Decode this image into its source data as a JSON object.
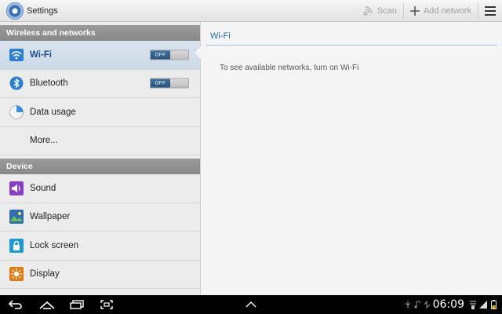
{
  "header": {
    "title": "Settings",
    "app_icon": "settings-gear-icon",
    "scan_label": "Scan",
    "add_network_label": "Add network"
  },
  "sidebar": {
    "sections": [
      {
        "header": "Wireless and networks",
        "items": [
          {
            "label": "Wi-Fi",
            "icon": "wifi-icon",
            "toggle": "OFF",
            "selected": true
          },
          {
            "label": "Bluetooth",
            "icon": "bluetooth-icon",
            "toggle": "OFF"
          },
          {
            "label": "Data usage",
            "icon": "data-usage-icon"
          },
          {
            "label": "More..."
          }
        ]
      },
      {
        "header": "Device",
        "items": [
          {
            "label": "Sound",
            "icon": "sound-icon"
          },
          {
            "label": "Wallpaper",
            "icon": "wallpaper-icon"
          },
          {
            "label": "Lock screen",
            "icon": "lock-icon"
          },
          {
            "label": "Display",
            "icon": "display-icon"
          }
        ]
      }
    ]
  },
  "detail": {
    "title": "Wi-Fi",
    "message": "To see available networks, turn on Wi-Fi"
  },
  "statusbar": {
    "time": "06:09"
  },
  "colors": {
    "accent": "#1f6aa5",
    "toggle_off": "#28557f",
    "section_header": "#888888"
  }
}
